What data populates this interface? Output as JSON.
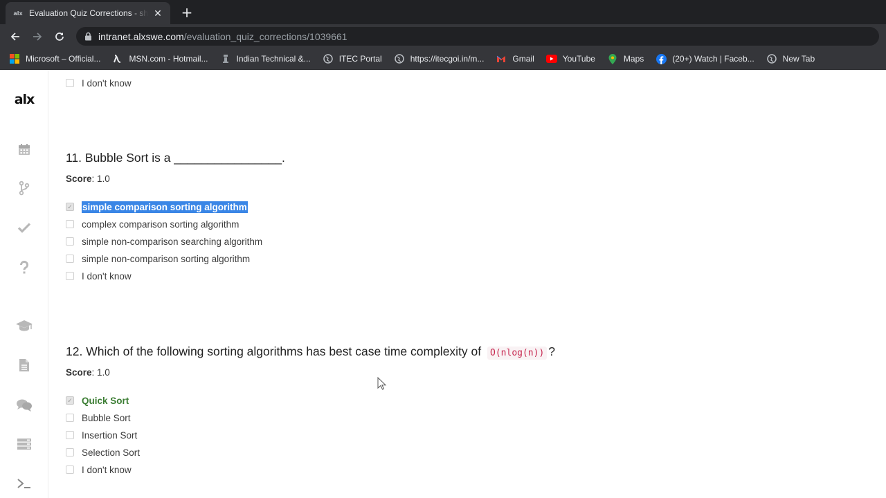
{
  "browser": {
    "tab_title": "Evaluation Quiz Corrections - sho",
    "tab_close": "✕",
    "new_tab": "+",
    "url_domain": "intranet.alxswe.com",
    "url_path": "/evaluation_quiz_corrections/1039661",
    "bookmarks": [
      {
        "label": "Microsoft – Official...",
        "icon": "windows-logo-icon"
      },
      {
        "label": "MSN.com - Hotmail...",
        "icon": "msn-icon"
      },
      {
        "label": "Indian Technical &...",
        "icon": "itec-icon"
      },
      {
        "label": "ITEC Portal",
        "icon": "globe-icon"
      },
      {
        "label": "https://itecgoi.in/m...",
        "icon": "globe-icon"
      },
      {
        "label": "Gmail",
        "icon": "gmail-icon"
      },
      {
        "label": "YouTube",
        "icon": "youtube-icon"
      },
      {
        "label": "Maps",
        "icon": "maps-icon"
      },
      {
        "label": "(20+) Watch | Faceb...",
        "icon": "facebook-icon"
      },
      {
        "label": "New Tab",
        "icon": "globe-icon"
      }
    ]
  },
  "sidebar": {
    "logo": "alx",
    "icons": [
      "calendar-icon",
      "branch-icon",
      "check-icon",
      "question-icon",
      "graduation-cap-icon",
      "document-icon",
      "chat-icon",
      "server-icon",
      "terminal-icon"
    ]
  },
  "prev_question": {
    "options": [
      "I don't know"
    ]
  },
  "q11": {
    "title": "11. Bubble Sort is a ________________.",
    "score_label": "Score",
    "score_value": ": 1.0",
    "options": [
      "simple comparison sorting algorithm",
      "complex comparison sorting algorithm",
      "simple non-comparison searching algorithm",
      "simple non-comparison sorting algorithm",
      "I don't know"
    ]
  },
  "q12": {
    "title_prefix": "12. Which of the following sorting algorithms has best case time complexity of",
    "code": "O(nlog(n))",
    "title_suffix": "?",
    "score_label": "Score",
    "score_value": ": 1.0",
    "options": [
      "Quick Sort",
      "Bubble Sort",
      "Insertion Sort",
      "Selection Sort",
      "I don't know"
    ]
  },
  "colors": {
    "highlight": "#3a86e6",
    "correct": "#3b7d33",
    "code": "#c7254e"
  }
}
